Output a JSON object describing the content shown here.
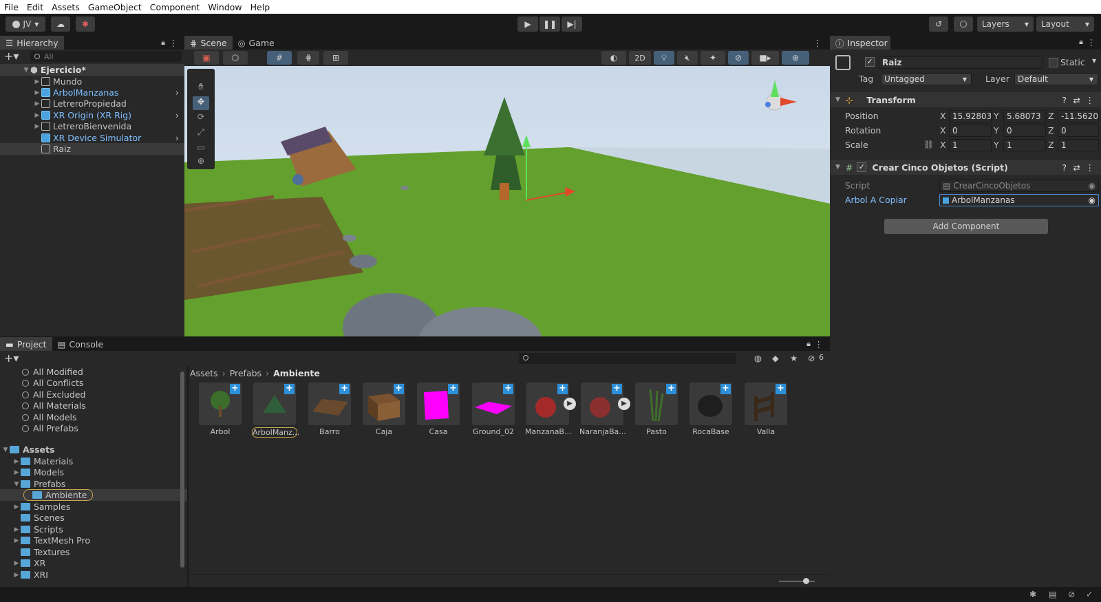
{
  "menu": [
    "File",
    "Edit",
    "Assets",
    "GameObject",
    "Component",
    "Window",
    "Help"
  ],
  "toolbar": {
    "account": "JV",
    "layers": "Layers",
    "layout": "Layout"
  },
  "hierarchy": {
    "tab": "Hierarchy",
    "search_placeholder": "All",
    "scene": "Ejercicio*",
    "items": [
      {
        "label": "Mundo",
        "prefab": false
      },
      {
        "label": "ArbolManzanas",
        "prefab": true
      },
      {
        "label": "LetreroPropiedad",
        "prefab": false
      },
      {
        "label": "XR Origin (XR Rig)",
        "prefab": true
      },
      {
        "label": "LetreroBienvenida",
        "prefab": false
      },
      {
        "label": "XR Device Simulator",
        "prefab": true
      },
      {
        "label": "Raiz",
        "prefab": false
      }
    ]
  },
  "scene_view": {
    "tab_scene": "Scene",
    "tab_game": "Game",
    "mode_2d": "2D"
  },
  "inspector": {
    "tab": "Inspector",
    "object_name": "Raiz",
    "static_label": "Static",
    "tag_label": "Tag",
    "tag_value": "Untagged",
    "layer_label": "Layer",
    "layer_value": "Default",
    "transform": {
      "title": "Transform",
      "position_label": "Position",
      "rotation_label": "Rotation",
      "scale_label": "Scale",
      "position": {
        "x": "15.92803",
        "y": "5.68073",
        "z": "-11.5620"
      },
      "rotation": {
        "x": "0",
        "y": "0",
        "z": "0"
      },
      "scale": {
        "x": "1",
        "y": "1",
        "z": "1"
      }
    },
    "script": {
      "title": "Crear Cinco Objetos (Script)",
      "script_label": "Script",
      "script_value": "CrearCincoObjetos",
      "field_label": "Arbol A Copiar",
      "field_value": "ArbolManzanas"
    },
    "add_component": "Add Component"
  },
  "project": {
    "tab_project": "Project",
    "tab_console": "Console",
    "badge_count": "6",
    "favorites": [
      "All Modified",
      "All Conflicts",
      "All Excluded",
      "All Materials",
      "All Models",
      "All Prefabs"
    ],
    "assets_root": "Assets",
    "folders": [
      "Materials",
      "Models",
      "Prefabs",
      "Ambiente",
      "Samples",
      "Scenes",
      "Scripts",
      "TextMesh Pro",
      "Textures",
      "XR",
      "XRI"
    ],
    "breadcrumb": [
      "Assets",
      "Prefabs",
      "Ambiente"
    ],
    "assets": [
      {
        "label": "Arbol"
      },
      {
        "label": "ArbolManz..."
      },
      {
        "label": "Barro"
      },
      {
        "label": "Caja"
      },
      {
        "label": "Casa"
      },
      {
        "label": "Ground_02"
      },
      {
        "label": "ManzanaB..."
      },
      {
        "label": "NaranjaBa..."
      },
      {
        "label": "Pasto"
      },
      {
        "label": "RocaBase"
      },
      {
        "label": "Valla"
      }
    ]
  }
}
